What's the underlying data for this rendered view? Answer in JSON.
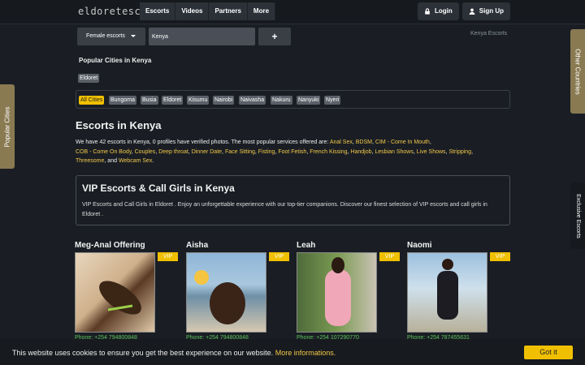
{
  "header": {
    "logo": "eldoretescorts",
    "nav": [
      "Escorts",
      "Videos",
      "Partners",
      "More"
    ],
    "login": "Login",
    "signup": "Sign Up"
  },
  "search": {
    "select_value": "Female escorts",
    "input_value": "Kenya",
    "add_label": "+",
    "country_link": "Kenya Escorts"
  },
  "popular": {
    "title": "Popular Cities in Kenya",
    "tag": "Eldoret"
  },
  "cities": [
    "All Cities",
    "Bungoma",
    "Busia",
    "Eldoret",
    "Kisumu",
    "Nairobi",
    "Naivasha",
    "Nakuru",
    "Nanyuki",
    "Nyeri"
  ],
  "main": {
    "title": "Escorts in Kenya",
    "desc_intro": "We have 42 escorts in Kenya, 0 profiles have verified photos. The most popular services offered are: ",
    "services": [
      "Anal Sex",
      "BDSM",
      "CIM - Come In Mouth",
      "COB - Come On Body",
      "Couples",
      "Deep throat",
      "Dinner Date",
      "Face Sitting",
      "Fisting",
      "Foot Fetish",
      "French Kissing",
      "Handjob",
      "Lesbian Shows",
      "Live Shows",
      "Stripping",
      "Threesome",
      "Webcam Sex"
    ],
    "and_word": "and"
  },
  "vip": {
    "title": "VIP Escorts & Call Girls in Kenya",
    "text": "VIP Escorts and Call Girls in Eldoret . Enjoy an unforgettable experience with our top-tier companions. Discover our finest selection of VIP escorts and call girls in Eldoret ."
  },
  "profiles": [
    {
      "name": "Meg-Anal Offering",
      "badge": "VIP",
      "phone": "Phone: +254 794800848"
    },
    {
      "name": "Aisha",
      "badge": "VIP",
      "phone": "Phone: +254 794800848"
    },
    {
      "name": "Leah",
      "badge": "VIP",
      "phone": "Phone: +254 107290770"
    },
    {
      "name": "Naomi",
      "badge": "VIP",
      "phone": "Phone: +254 787455631"
    }
  ],
  "side_tabs": {
    "left": "Popular Cities",
    "right_top": "Other Countries",
    "right_bottom": "Exclusive Escorts"
  },
  "cookie": {
    "text": "This website uses cookies to ensure you get the best experience on our website.",
    "link": "More informations.",
    "button": "Got it"
  },
  "colors": {
    "accent": "#f0c000",
    "link": "#f2c84a",
    "phone": "#5cc45c",
    "side_tab": "#8a7a52"
  }
}
